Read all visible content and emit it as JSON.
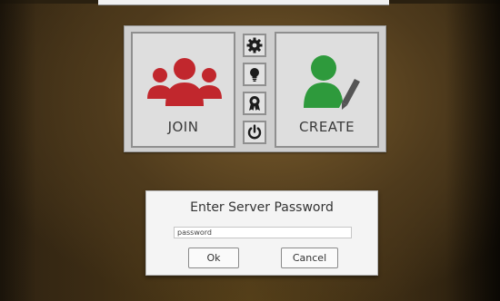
{
  "main_menu": {
    "join_label": "JOIN",
    "create_label": "CREATE",
    "join_icon": "group-icon",
    "create_icon": "user-edit-icon",
    "side_icons": [
      "gear-icon",
      "lightbulb-icon",
      "award-ribbon-icon",
      "power-icon"
    ],
    "colors": {
      "join_red": "#c1272d",
      "create_green": "#2e9a3c",
      "icon_dark": "#1c1c1c"
    }
  },
  "password_dialog": {
    "title": "Enter Server Password",
    "input_value": "password",
    "ok_label": "Ok",
    "cancel_label": "Cancel"
  }
}
